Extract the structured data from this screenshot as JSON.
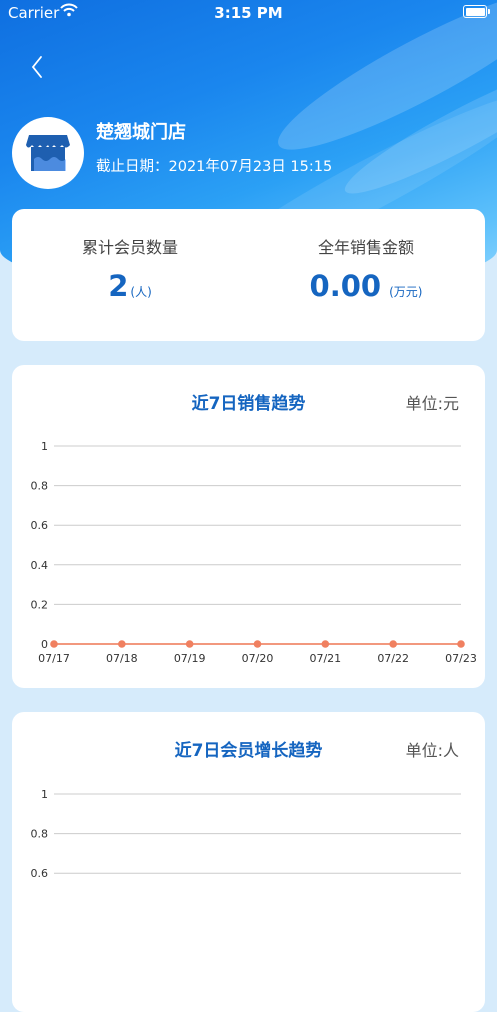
{
  "status_bar": {
    "carrier": "Carrier",
    "time": "3:15 PM"
  },
  "store": {
    "name": "楚翘城门店",
    "deadline": "截止日期：2021年07月23日 15:15"
  },
  "summary": {
    "members_label": "累计会员数量",
    "members_value": "2",
    "members_unit": "(人)",
    "sales_label": "全年销售金额",
    "sales_value": "0.00",
    "sales_unit": "(万元)"
  },
  "sales_chart": {
    "title": "近7日销售趋势",
    "unit": "单位:元"
  },
  "member_chart": {
    "title": "近7日会员增长趋势",
    "unit": "单位:人"
  },
  "colors": {
    "accent": "#1565c0",
    "line": "#f08060",
    "grid": "#cccccc"
  },
  "icons": {
    "back": "chevron-left-icon",
    "store": "store-awning-icon",
    "wifi": "wifi-icon",
    "battery": "battery-icon"
  },
  "chart_data": [
    {
      "type": "line",
      "title": "近7日销售趋势",
      "categories": [
        "07/17",
        "07/18",
        "07/19",
        "07/20",
        "07/21",
        "07/22",
        "07/23"
      ],
      "series": [
        {
          "values": [
            0,
            0,
            0,
            0,
            0,
            0,
            0
          ]
        }
      ],
      "yticks": [
        "0",
        "0.2",
        "0.4",
        "0.6",
        "0.8",
        "1"
      ],
      "ylim": [
        0,
        1
      ],
      "grid": true
    },
    {
      "type": "line",
      "title": "近7日会员增长趋势",
      "categories": [],
      "series": [],
      "yticks": [
        "0.6",
        "0.8",
        "1"
      ],
      "ylim": [
        0,
        1
      ],
      "grid": true
    }
  ]
}
